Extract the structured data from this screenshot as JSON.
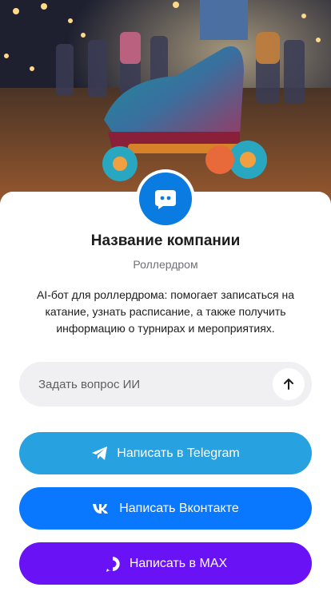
{
  "company": {
    "name": "Название компании",
    "type": "Роллердром",
    "description": "AI-бот для роллердрома: помогает записаться на катание, узнать расписание, а также получить информацию о турнирах и мероприятиях."
  },
  "ask": {
    "placeholder": "Задать вопрос ИИ"
  },
  "buttons": {
    "telegram": "Написать в Telegram",
    "vk": "Написать Вконтакте",
    "max": "Написать в MAX"
  },
  "colors": {
    "telegram": "#27a1e0",
    "vk": "#0a77ff",
    "max": "#6912f5",
    "logo": "#0a7be0"
  },
  "icons": {
    "logo": "chat-bot-icon",
    "send": "arrow-up-icon",
    "telegram": "telegram-icon",
    "vk": "vk-icon",
    "max": "max-icon"
  }
}
